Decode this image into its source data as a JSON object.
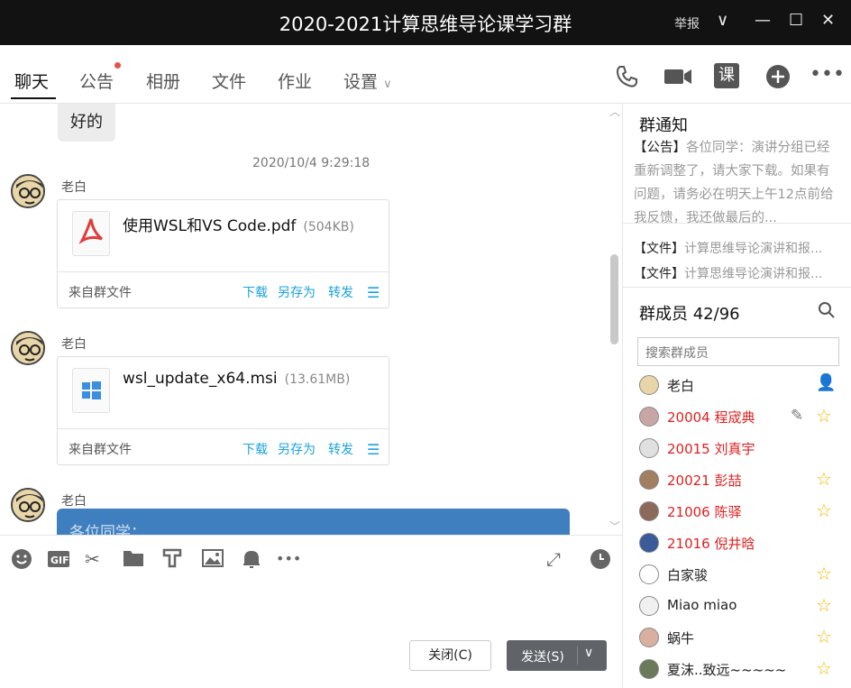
{
  "window": {
    "title": "2020-2021计算思维导论课学习群",
    "report": "举报"
  },
  "tabs": [
    {
      "label": "聊天"
    },
    {
      "label": "公告"
    },
    {
      "label": "相册"
    },
    {
      "label": "文件"
    },
    {
      "label": "作业"
    },
    {
      "label": "设置"
    }
  ],
  "toolbar_icons": [
    "call-icon",
    "video-icon",
    "class-icon",
    "add-icon",
    "more-icon"
  ],
  "toolbar_class_glyph": "课",
  "chat": {
    "prev_bubble": "好的",
    "timestamp": "2020/10/4 9:29:18",
    "messages": [
      {
        "sender": "老白",
        "file_name": "使用WSL和VS Code.pdf",
        "file_size": "(504KB)",
        "source": "来自群文件",
        "actions": [
          "下载",
          "另存为",
          "转发"
        ]
      },
      {
        "sender": "老白",
        "file_name": "wsl_update_x64.msi",
        "file_size": "(13.61MB)",
        "source": "来自群文件",
        "actions": [
          "下载",
          "另存为",
          "转发"
        ]
      },
      {
        "sender": "老白",
        "text_preview": "各位同学："
      }
    ]
  },
  "input": {
    "tools": [
      "emoji-icon",
      "gif-icon",
      "screenshot-icon",
      "folder-icon",
      "note-icon",
      "image-icon",
      "bell-icon",
      "more-icon"
    ],
    "close_label": "关闭(C)",
    "send_label": "发送(S)"
  },
  "sidebar": {
    "notice_title": "群通知",
    "notice_tag": "【公告】",
    "notice_text": "各位同学：演讲分组已经重新调整了，请大家下载。如果有问题，请务必在明天上午12点前给我反馈，我还做最后的...",
    "files": [
      {
        "tag": "【文件】",
        "text": "计算思维导论演讲和报..."
      },
      {
        "tag": "【文件】",
        "text": "计算思维导论演讲和报..."
      }
    ],
    "members_title": "群成员 42/96",
    "search_placeholder": "搜索群成员",
    "members": [
      {
        "name": "老白",
        "red": false,
        "badge": "owner"
      },
      {
        "name": "20004 程宬典",
        "red": true,
        "badge": "star",
        "pencil": true
      },
      {
        "name": "20015 刘真宇",
        "red": true,
        "badge": ""
      },
      {
        "name": "20021 彭喆",
        "red": true,
        "badge": "star"
      },
      {
        "name": "21006 陈驿",
        "red": true,
        "badge": "star"
      },
      {
        "name": "21016 倪井晗",
        "red": true,
        "badge": ""
      },
      {
        "name": "白家骏",
        "red": false,
        "badge": "star"
      },
      {
        "name": "Miao miao",
        "red": false,
        "badge": "star"
      },
      {
        "name": "蜗牛",
        "red": false,
        "badge": "star"
      },
      {
        "name": "夏沫..致远~~~~~",
        "red": false,
        "badge": "star"
      }
    ]
  }
}
